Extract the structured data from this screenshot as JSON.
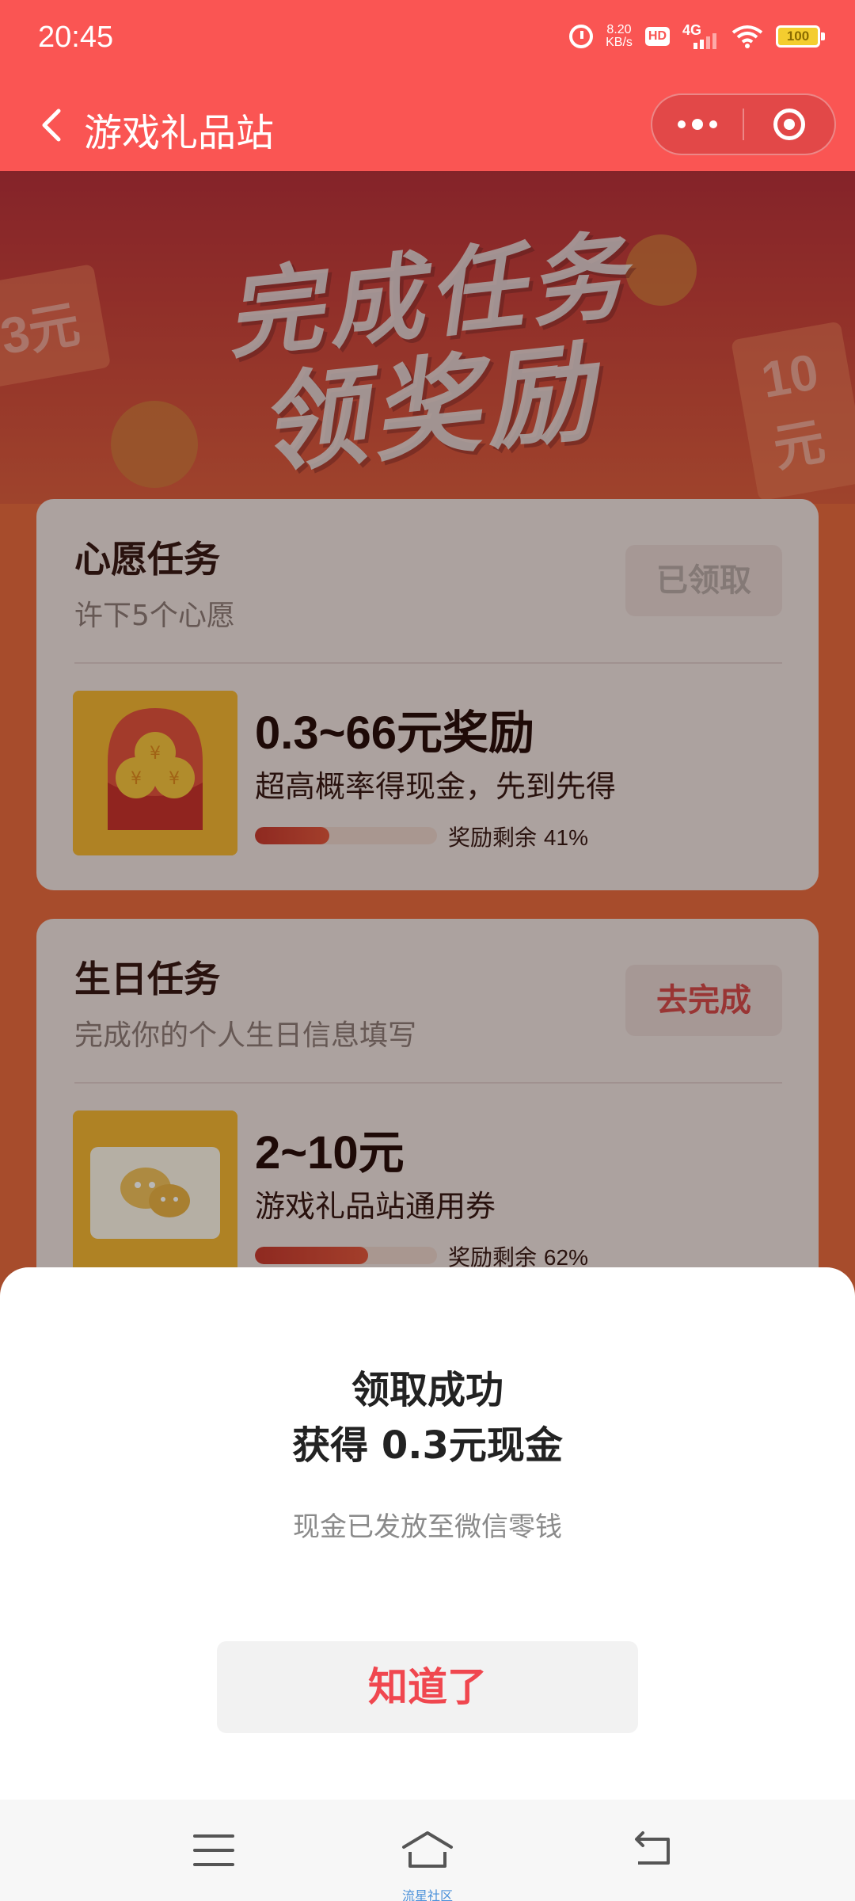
{
  "status_bar": {
    "time": "20:45",
    "net_speed_value": "8.20",
    "net_speed_unit": "KB/s",
    "hd_badge": "HD",
    "network": "4G",
    "battery": "100",
    "icons": [
      "alarm-icon",
      "hd-icon",
      "signal-4g-icon",
      "wifi-icon",
      "battery-icon"
    ]
  },
  "header": {
    "back_icon": "chevron-left-icon",
    "title": "游戏礼品站",
    "capsule_icons": [
      "more-icon",
      "close-target-icon"
    ]
  },
  "banner": {
    "line1": "完成任务",
    "line2": "领奖励",
    "deco_ticket_left": "3元",
    "deco_ticket_right": "10元"
  },
  "tasks": [
    {
      "title": "心愿任务",
      "subtitle": "许下5个心愿",
      "button": "已领取",
      "button_state": "disabled",
      "reward_title": "0.3~66元奖励",
      "reward_desc": "超高概率得现金，先到先得",
      "remain_label": "奖励剩余",
      "remain_percent": "41%",
      "remain_fraction": 0.41,
      "thumb_icon": "red-envelope-icon"
    },
    {
      "title": "生日任务",
      "subtitle": "完成你的个人生日信息填写",
      "button": "去完成",
      "button_state": "active",
      "reward_title": "2~10元",
      "reward_desc": "游戏礼品站通用券",
      "remain_label": "奖励剩余",
      "remain_percent": "62%",
      "remain_fraction": 0.62,
      "thumb_icon": "wechat-coupon-icon"
    }
  ],
  "dialog": {
    "title_line1": "领取成功",
    "title_line2": "获得 0.3元现金",
    "description": "现金已发放至微信零钱",
    "confirm_button": "知道了"
  },
  "system_nav": {
    "icons": [
      "menu-icon",
      "home-icon",
      "back-icon"
    ],
    "home_caption": "流星社区"
  },
  "colors": {
    "header_bg": "#fa5553",
    "accent_red": "#f0474f",
    "card_bg": "#efe1dd",
    "thumb_yellow": "#f3b433"
  }
}
